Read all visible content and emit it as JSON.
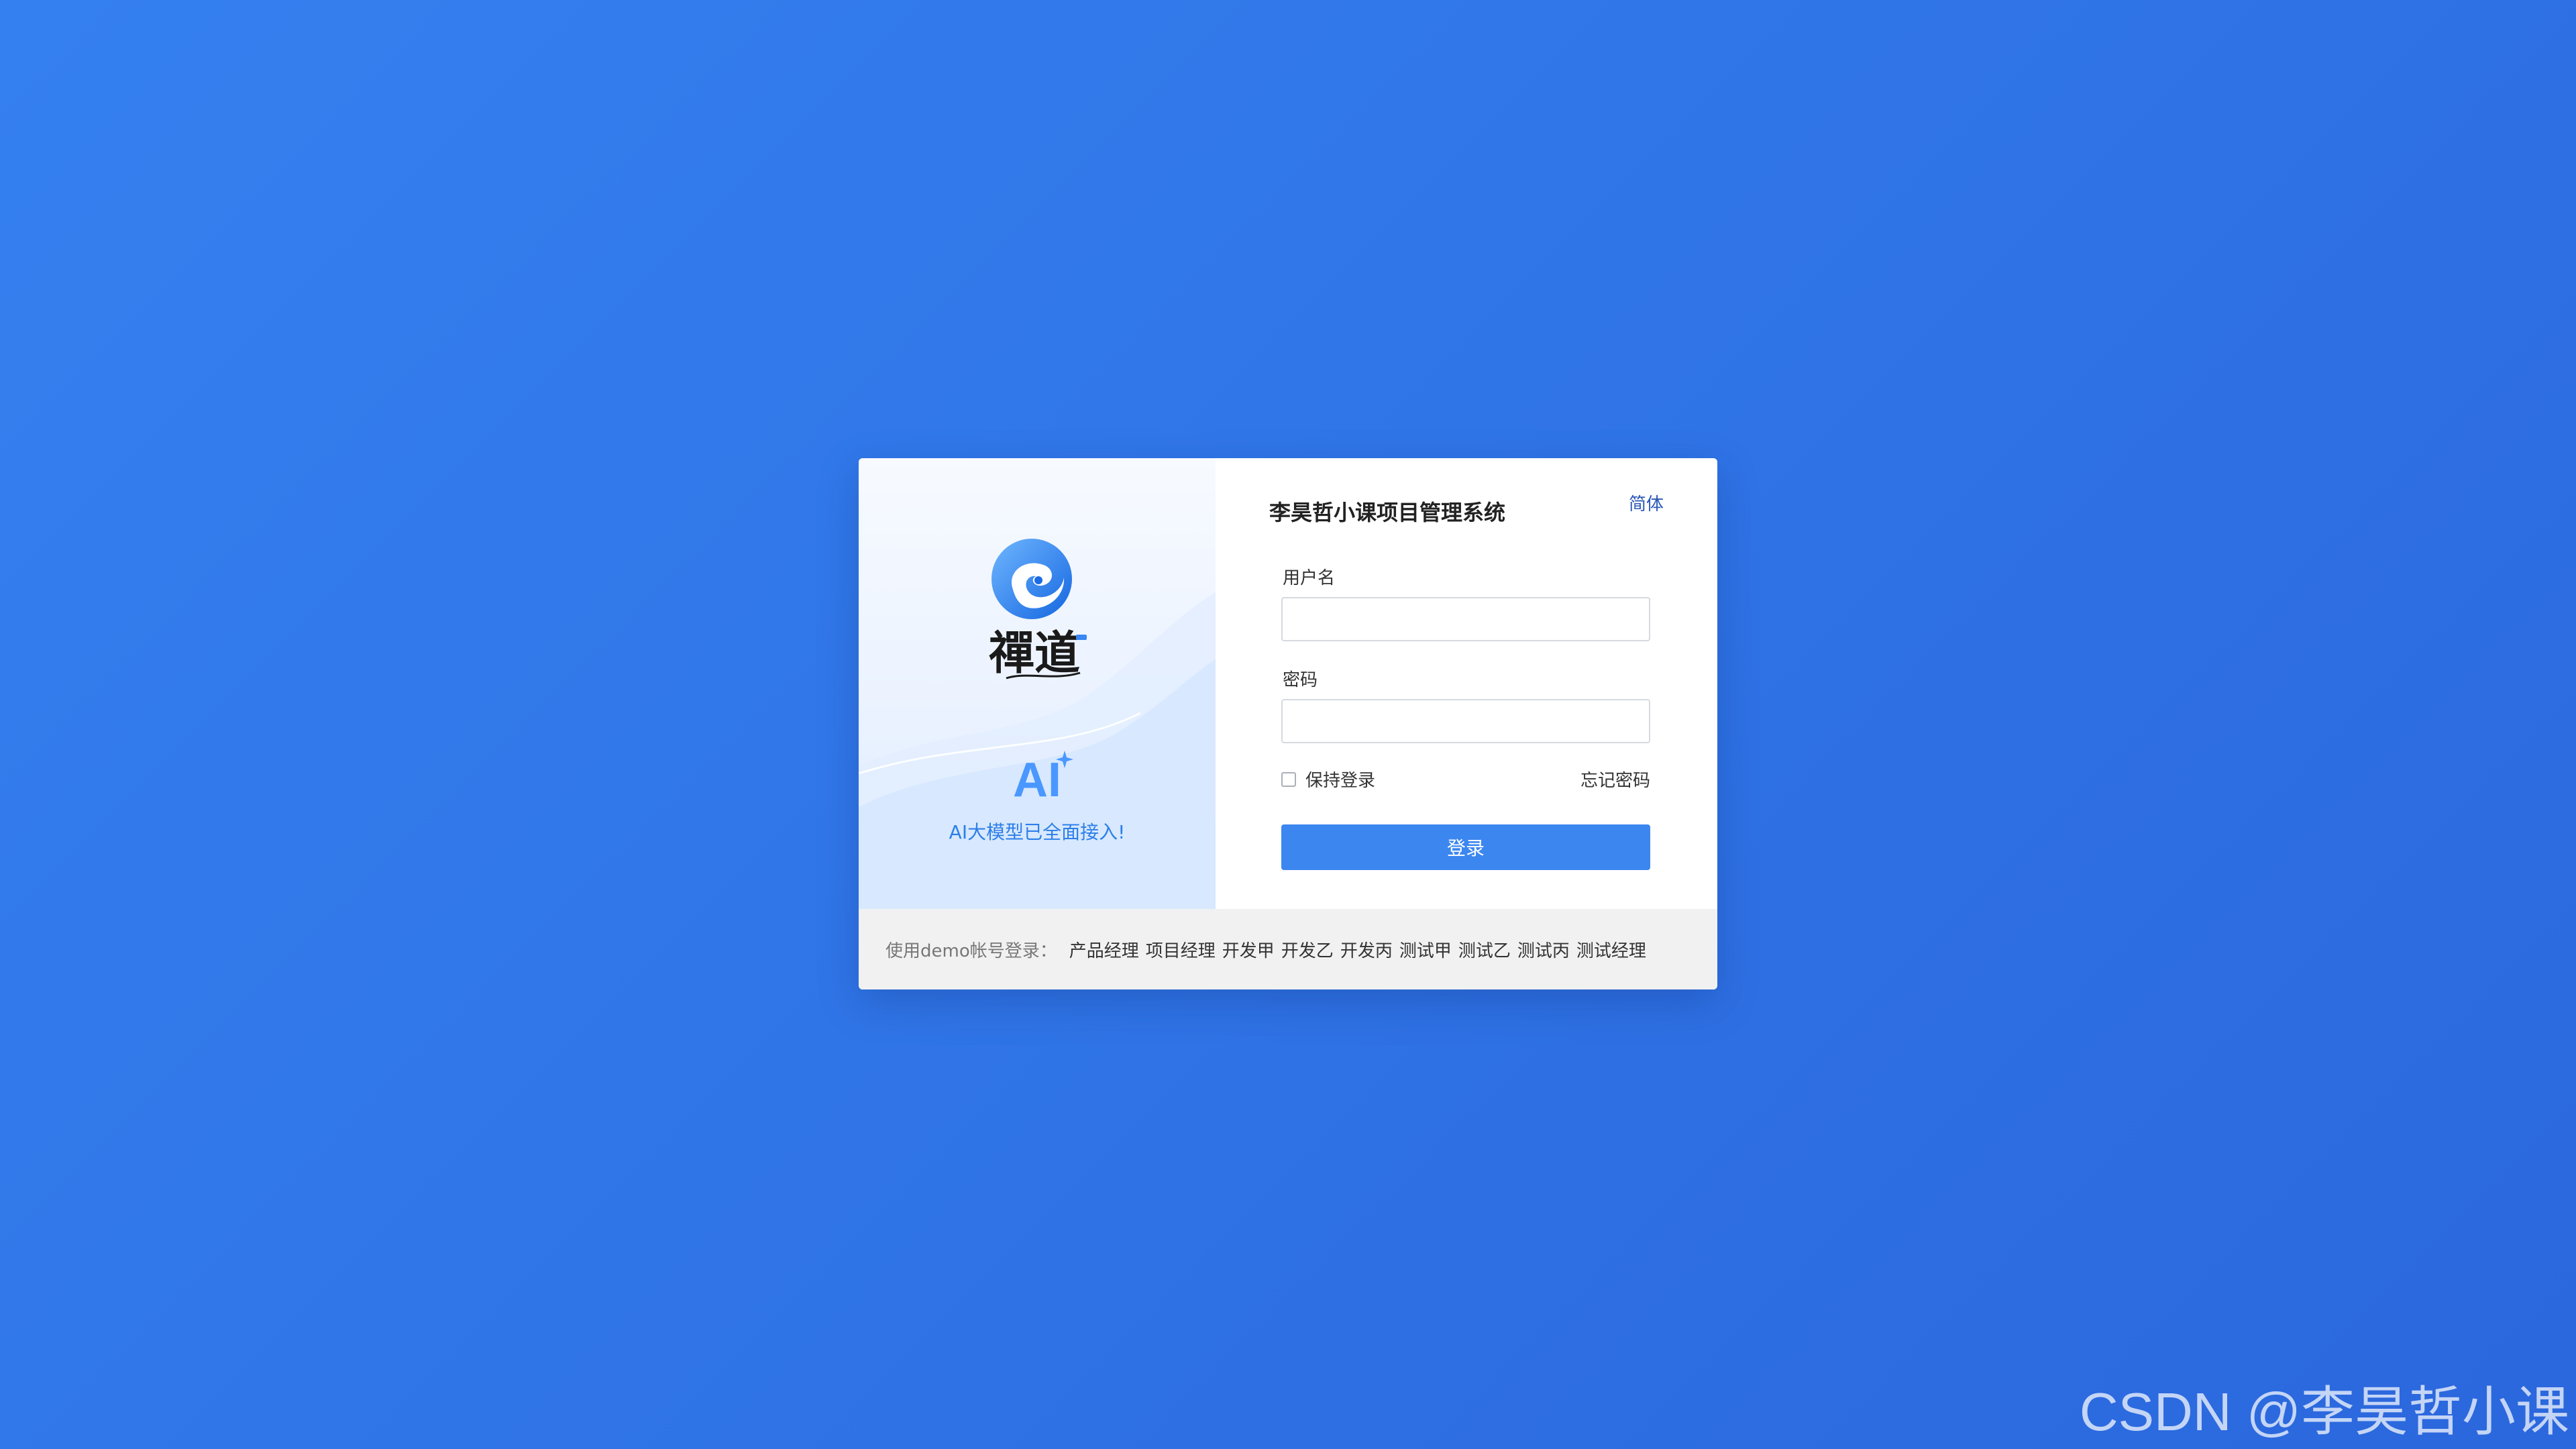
{
  "system": {
    "title": "李昊哲小课项目管理系统",
    "language": "简体"
  },
  "brand": {
    "logo_icon": "swirl-logo-icon",
    "logo_text": "禪道",
    "ai_badge": "AI",
    "ai_tagline": "AI大模型已全面接入!"
  },
  "form": {
    "username_label": "用户名",
    "username_value": "",
    "password_label": "密码",
    "password_value": "",
    "remember_label": "保持登录",
    "remember_checked": false,
    "forgot_label": "忘记密码",
    "login_button": "登录"
  },
  "demo": {
    "label": "使用demo帐号登录：",
    "accounts": [
      "产品经理",
      "项目经理",
      "开发甲",
      "开发乙",
      "开发丙",
      "测试甲",
      "测试乙",
      "测试丙",
      "测试经理"
    ]
  },
  "watermark": "CSDN @李昊哲小课",
  "colors": {
    "background": "#3078ec",
    "primary_button": "#3c86f0",
    "link": "#2b57b7",
    "ai_blue": "#4a98ff"
  }
}
